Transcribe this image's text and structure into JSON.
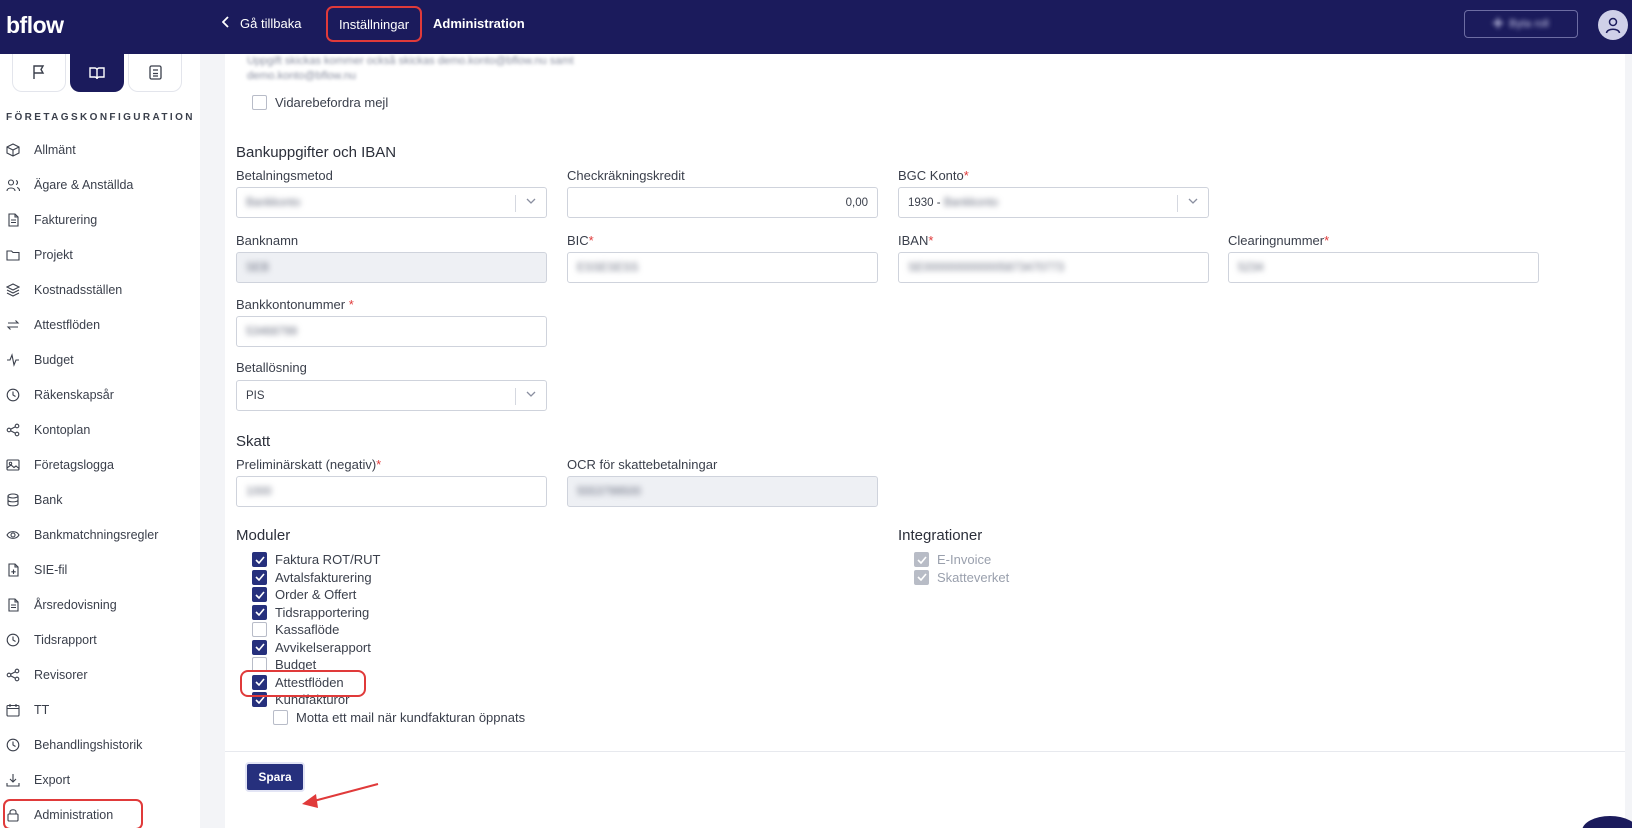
{
  "header": {
    "logo": "bflow",
    "back_label": "Gå tillbaka",
    "breadcrumb_settings": "Inställningar",
    "breadcrumb_current": "Administration",
    "top_button": "Byta roll"
  },
  "sidebar": {
    "section_title": "FÖRETAGSKONFIGURATION",
    "items": [
      {
        "label": "Allmänt",
        "icon": "cube-icon"
      },
      {
        "label": "Ägare & Anställda",
        "icon": "users-icon"
      },
      {
        "label": "Fakturering",
        "icon": "document-icon"
      },
      {
        "label": "Projekt",
        "icon": "folder-icon"
      },
      {
        "label": "Kostnadsställen",
        "icon": "layers-icon"
      },
      {
        "label": "Attestflöden",
        "icon": "arrows-icon"
      },
      {
        "label": "Budget",
        "icon": "activity-icon"
      },
      {
        "label": "Räkenskapsår",
        "icon": "clock-icon"
      },
      {
        "label": "Kontoplan",
        "icon": "share-icon"
      },
      {
        "label": "Företagslogga",
        "icon": "image-icon"
      },
      {
        "label": "Bank",
        "icon": "database-icon"
      },
      {
        "label": "Bankmatchningsregler",
        "icon": "eye-icon"
      },
      {
        "label": "SIE-fil",
        "icon": "file-plus-icon"
      },
      {
        "label": "Årsredovisning",
        "icon": "document-icon"
      },
      {
        "label": "Tidsrapport",
        "icon": "clock-icon"
      },
      {
        "label": "Revisorer",
        "icon": "share-icon"
      },
      {
        "label": "TT",
        "icon": "calendar-icon"
      },
      {
        "label": "Behandlingshistorik",
        "icon": "clock-icon"
      },
      {
        "label": "Export",
        "icon": "download-icon"
      },
      {
        "label": "Administration",
        "icon": "lock-icon",
        "active": true
      }
    ]
  },
  "main": {
    "forward_mail_label": "Vidarebefordra mejl",
    "bank_section": "Bankuppgifter och IBAN",
    "payment_method": {
      "label": "Betalningsmetod",
      "value": "Bankkonto"
    },
    "overdraft": {
      "label": "Checkräkningskredit",
      "value": "0,00"
    },
    "bgc_account": {
      "label": "BGC Konto",
      "value_prefix": "1930 -",
      "value_hidden": "Bankkonto"
    },
    "bank_name": {
      "label": "Banknamn",
      "value": "SEB"
    },
    "bic": {
      "label": "BIC",
      "value": "ESSESESS"
    },
    "iban": {
      "label": "IBAN",
      "value": "SE0000000000005873470773"
    },
    "clearing": {
      "label": "Clearingnummer",
      "value": "5234"
    },
    "account_number": {
      "label": "Bankkontonummer",
      "value": "53468799"
    },
    "payment_solution": {
      "label": "Betallösning",
      "value": "PIS"
    },
    "tax_section": "Skatt",
    "prelim_tax": {
      "label": "Preliminärskatt (negativ)",
      "value": "1000"
    },
    "ocr": {
      "label": "OCR för skattebetalningar",
      "value": "5553799500"
    },
    "modules_section": "Moduler",
    "modules": [
      {
        "label": "Faktura ROT/RUT",
        "checked": true
      },
      {
        "label": "Avtalsfakturering",
        "checked": true
      },
      {
        "label": "Order & Offert",
        "checked": true
      },
      {
        "label": "Tidsrapportering",
        "checked": true
      },
      {
        "label": "Kassaflöde",
        "checked": false
      },
      {
        "label": "Avvikelserapport",
        "checked": true
      },
      {
        "label": "Budget",
        "checked": false
      },
      {
        "label": "Attestflöden",
        "checked": true
      },
      {
        "label": "Kundfakturor",
        "checked": true
      }
    ],
    "sub_option": {
      "label": "Motta ett mail när kundfakturan öppnats",
      "checked": false
    },
    "integrations_section": "Integrationer",
    "integrations": [
      {
        "label": "E-Invoice",
        "checked": true
      },
      {
        "label": "Skatteverket",
        "checked": true
      }
    ],
    "save_label": "Spara"
  },
  "colors": {
    "navy": "#1b1b5c",
    "accent": "#26307d",
    "annotation": "#e03a3a",
    "required": "#e03a3a"
  }
}
